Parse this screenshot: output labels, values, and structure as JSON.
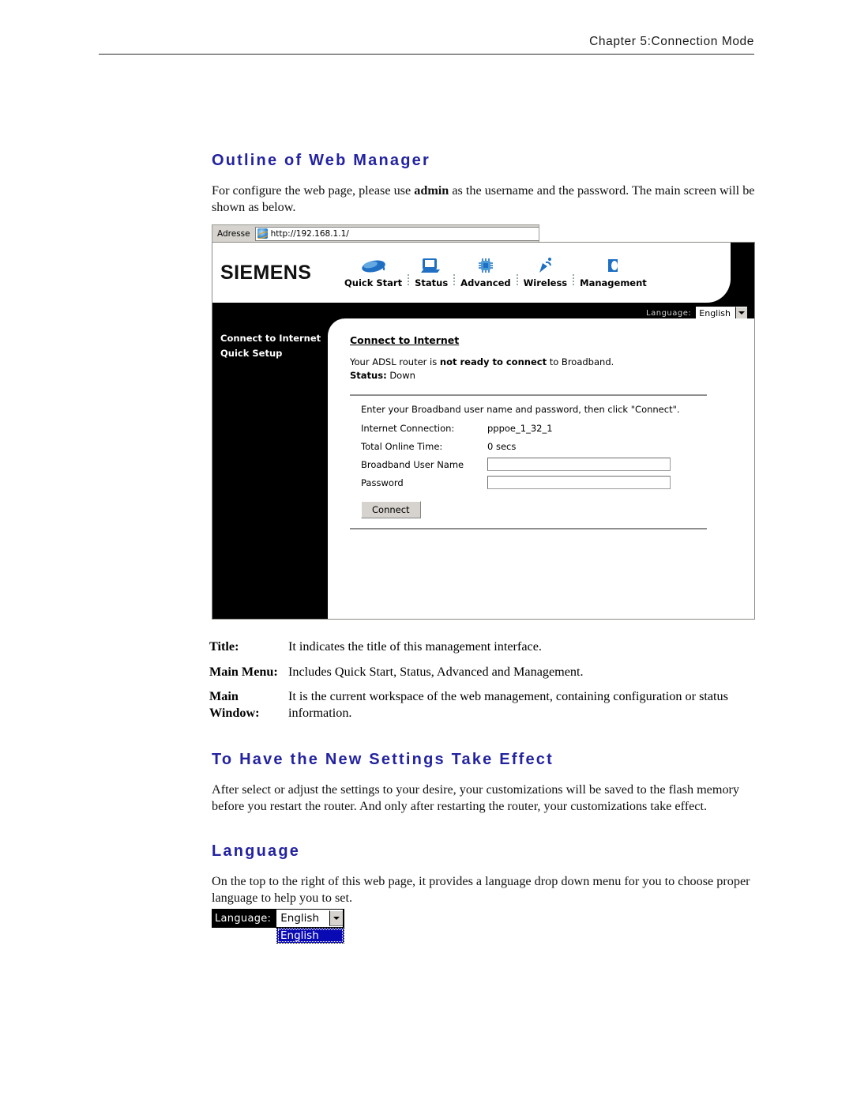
{
  "page_header": "Chapter 5:Connection Mode",
  "sections": {
    "outline": {
      "title": "Outline of Web Manager",
      "paragraph_pre": "For configure the web page, please use ",
      "paragraph_bold": "admin",
      "paragraph_post": " as the username and the password. The main screen will be shown as below."
    },
    "take_effect": {
      "title": "To Have the New Settings Take Effect",
      "paragraph": "After select or adjust the settings to your desire, your customizations will be saved to the flash memory before you restart the router. And only after restarting the router, your customizations take effect."
    },
    "language": {
      "title": "Language",
      "paragraph": "On the top to the right of this web page, it provides a language drop down menu for you to choose proper language to help you to set."
    }
  },
  "router_screenshot": {
    "address_bar": {
      "label": "Adresse",
      "url": "http://192.168.1.1/",
      "icon": "internet-explorer-icon"
    },
    "brand": "SIEMENS",
    "main_menu": [
      {
        "label": "Quick Start",
        "icon": "mouse-icon"
      },
      {
        "label": "Status",
        "icon": "monitor-icon"
      },
      {
        "label": "Advanced",
        "icon": "chip-icon"
      },
      {
        "label": "Wireless",
        "icon": "antenna-icon"
      },
      {
        "label": "Management",
        "icon": "box-icon"
      }
    ],
    "language_bar": {
      "label": "Language:",
      "value": "English"
    },
    "sidebar": [
      "Connect to Internet",
      "Quick Setup"
    ],
    "main_window": {
      "title": "Connect to Internet",
      "status_pre": "Your ADSL router is ",
      "status_bold": "not ready to connect",
      "status_post": " to Broadband.",
      "status_label": "Status:",
      "status_value": "Down",
      "panel_hint": "Enter your Broadband user name and password, then click \"Connect\".",
      "fields": [
        {
          "label": "Internet Connection:",
          "value": "pppoe_1_32_1",
          "type": "readonly"
        },
        {
          "label": "Total Online Time:",
          "value": "0 secs",
          "type": "readonly"
        },
        {
          "label": "Broadband User Name",
          "value": "",
          "type": "text"
        },
        {
          "label": "Password",
          "value": "",
          "type": "password"
        }
      ],
      "connect_button": "Connect"
    }
  },
  "definition_list": [
    {
      "term": "Title:",
      "desc": "It indicates the title of this management interface."
    },
    {
      "term": "Main Menu:",
      "desc": "Includes Quick Start, Status, Advanced and Management."
    },
    {
      "term": "Main Window:",
      "desc": "It is the current workspace of the web management, containing configuration or status information."
    }
  ],
  "language_widget": {
    "label": "Language:",
    "value": "English",
    "options": [
      "English"
    ]
  },
  "colors": {
    "heading_blue": "#2323a0",
    "selection_blue": "#0a0ab4",
    "icon_blue": "#1f6fc4",
    "chrome_gray": "#d6d3ce"
  }
}
